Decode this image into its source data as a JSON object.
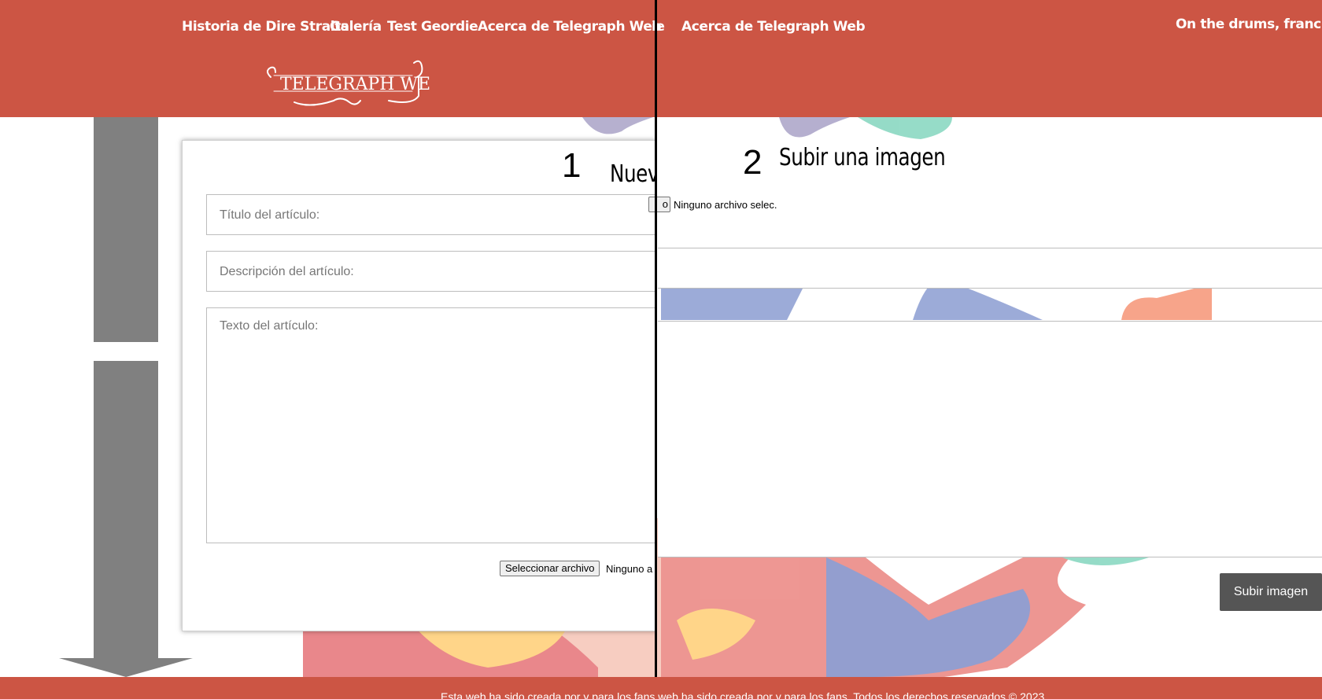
{
  "header": {
    "nav_left": [
      "Historia de Dire Straits",
      "Galería",
      "Test Geordie",
      "Acerca de Telegraph Web"
    ],
    "nav_right_partial": "ie",
    "nav_right": "Acerca de Telegraph Web",
    "user_greeting": "On the drums, francisco!",
    "logo_text": "TELEGRAPH WEB"
  },
  "left_panel": {
    "step_number": "1",
    "title": "Nuevo",
    "title_placeholder": "Título del artículo:",
    "description_placeholder": "Descripción del artículo:",
    "text_placeholder": "Texto del artículo:",
    "file_button": "Seleccionar archivo",
    "file_status": "Ninguno a"
  },
  "right_panel": {
    "step_number": "2",
    "title": "Subir una imagen",
    "file_button_partial": "o",
    "file_status": "Ninguno archivo selec.",
    "submit_button": "Subir imagen"
  },
  "footer": {
    "text": "Esta web ha sido creada por y para los fans web ha sido creada por y para los fans. Todos los derechos reservados © 2023"
  },
  "colors": {
    "brand": "#cc5544",
    "button_dark": "#555555",
    "arrow": "#808080"
  }
}
